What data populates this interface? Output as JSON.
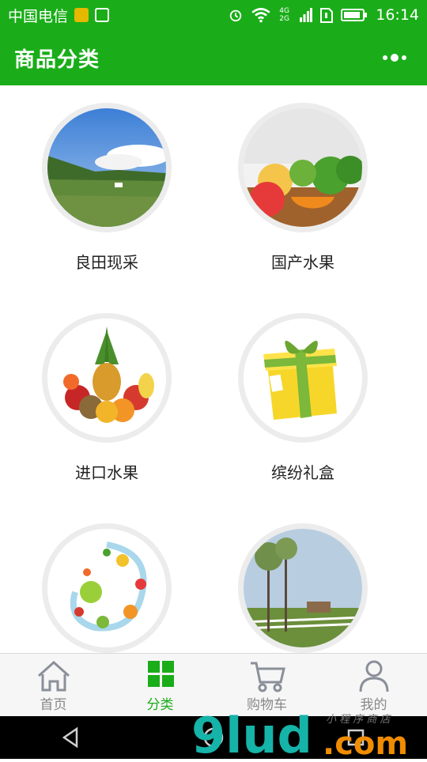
{
  "status_bar": {
    "carrier": "中国电信",
    "network": "4G 2G",
    "time": "16:14"
  },
  "header": {
    "title": "商品分类",
    "more_icon": "more-dots-icon"
  },
  "categories": [
    {
      "label": "良田现采",
      "image": "farm-field-image"
    },
    {
      "label": "国产水果",
      "image": "domestic-fruit-image"
    },
    {
      "label": "进口水果",
      "image": "imported-fruit-image"
    },
    {
      "label": "缤纷礼盒",
      "image": "gift-box-image"
    },
    {
      "label": "",
      "image": "fruit-splash-image"
    },
    {
      "label": "",
      "image": "ranch-image"
    }
  ],
  "tabbar": {
    "tabs": [
      {
        "label": "首页",
        "icon": "home-icon",
        "active": false
      },
      {
        "label": "分类",
        "icon": "grid-icon",
        "active": true
      },
      {
        "label": "购物车",
        "icon": "cart-icon",
        "active": false
      },
      {
        "label": "我的",
        "icon": "user-icon",
        "active": false
      }
    ]
  },
  "watermark": {
    "text": "9lud.com",
    "subtext": "小程序商店"
  },
  "colors": {
    "brand_green": "#1aad19",
    "tab_inactive": "#888888",
    "watermark_teal": "#15b3a8",
    "watermark_orange": "#f08c00"
  }
}
